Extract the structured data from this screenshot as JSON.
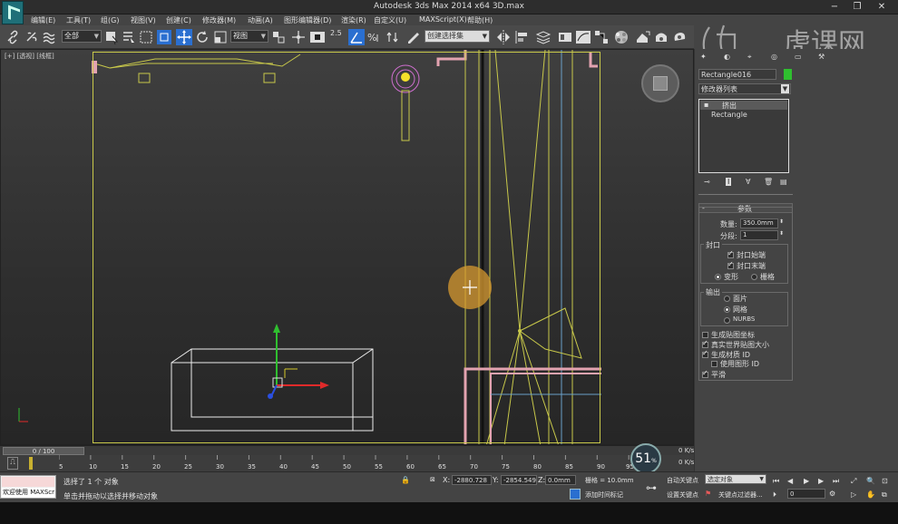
{
  "title": "Autodesk 3ds Max  2014 x64      3D.max",
  "window_controls": {
    "minimize": "−",
    "restore": "❐",
    "close": "✕"
  },
  "menu": [
    "编辑(E)",
    "工具(T)",
    "组(G)",
    "视图(V)",
    "创建(C)",
    "修改器(M)",
    "动画(A)",
    "图形编辑器(D)",
    "渲染(R)",
    "自定义(U)",
    "MAXScript(X)",
    "帮助(H)"
  ],
  "toolbar": {
    "selection_filter": "全部",
    "reference_coord": "视图",
    "snap_label": "2.5",
    "named_selection": "创建选择集"
  },
  "watermark": "虎课网",
  "viewport": {
    "label": "[+] [透视] [线框]"
  },
  "command_panel": {
    "object_name": "Rectangle016",
    "object_color": "#2fbf2f",
    "modifier_list": "修改器列表",
    "stack": [
      "挤出",
      "Rectangle"
    ],
    "rollout_title": "参数",
    "amount_label": "数量:",
    "amount_value": "350.0mm",
    "segments_label": "分段:",
    "segments_value": "1",
    "capping_title": "封口",
    "cap_start": "封口始端",
    "cap_end": "封口末端",
    "morph": "变形",
    "grid": "栅格",
    "output_title": "输出",
    "output_patch": "面片",
    "output_mesh": "网格",
    "output_nurbs": "NURBS",
    "gen_map_coords": "生成贴图坐标",
    "real_world_map": "真实世界贴图大小",
    "gen_mat_ids": "生成材质 ID",
    "use_shape_ids": "使用图形 ID",
    "smooth": "平滑"
  },
  "timeline": {
    "frame_display": "0 / 100",
    "ticks": [
      "0",
      "5",
      "10",
      "15",
      "20",
      "25",
      "30",
      "35",
      "40",
      "45",
      "50",
      "55",
      "60",
      "65",
      "70",
      "75",
      "80",
      "85",
      "90",
      "95"
    ]
  },
  "status": {
    "listener_text": "欢迎使用 MAXScri",
    "selection_status": "选择了 1 个 对象",
    "prompt": "单击并拖动以选择并移动对象",
    "x_label": "X:",
    "x_value": "-2880.728",
    "y_label": "Y:",
    "y_value": "-2854.549",
    "z_label": "Z:",
    "z_value": "0.0mm",
    "grid_label": "栅格 = 10.0mm",
    "add_time_tag": "添加时间标记",
    "auto_key": "自动关键点",
    "set_key": "设置关键点",
    "selected_object": "选定对象",
    "key_filters": "关键点过滤器...",
    "frame_field": "0"
  },
  "fps": {
    "value": "51",
    "unit": "%",
    "stat1": "0",
    "stat1_unit": "K/s",
    "stat2": "0",
    "stat2_unit": "K/s"
  }
}
